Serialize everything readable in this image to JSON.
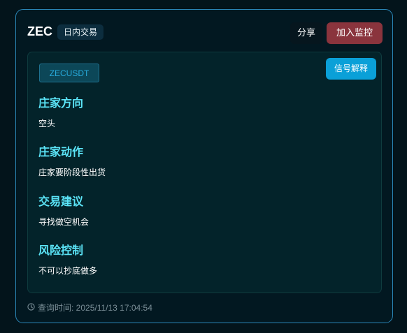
{
  "header": {
    "symbol": "ZEC",
    "period_badge": "日内交易",
    "share_label": "分享",
    "monitor_label": "加入监控"
  },
  "signal": {
    "pair": "ZECUSDT",
    "explain_label": "信号解释",
    "sections": [
      {
        "title": "庄家方向",
        "value": "空头"
      },
      {
        "title": "庄家动作",
        "value": "庄家要阶段性出货"
      },
      {
        "title": "交易建议",
        "value": "寻找做空机会"
      },
      {
        "title": "风险控制",
        "value": "不可以抄底做多"
      }
    ]
  },
  "footer": {
    "icon": "clock-icon",
    "query_time": "查询时间: 2025/11/13 17:04:54"
  },
  "colors": {
    "accent_cyan": "#5be4f7",
    "monitor_red": "#8a343d",
    "explain_blue": "#0aa0d8",
    "card_border": "#2b87b8"
  }
}
